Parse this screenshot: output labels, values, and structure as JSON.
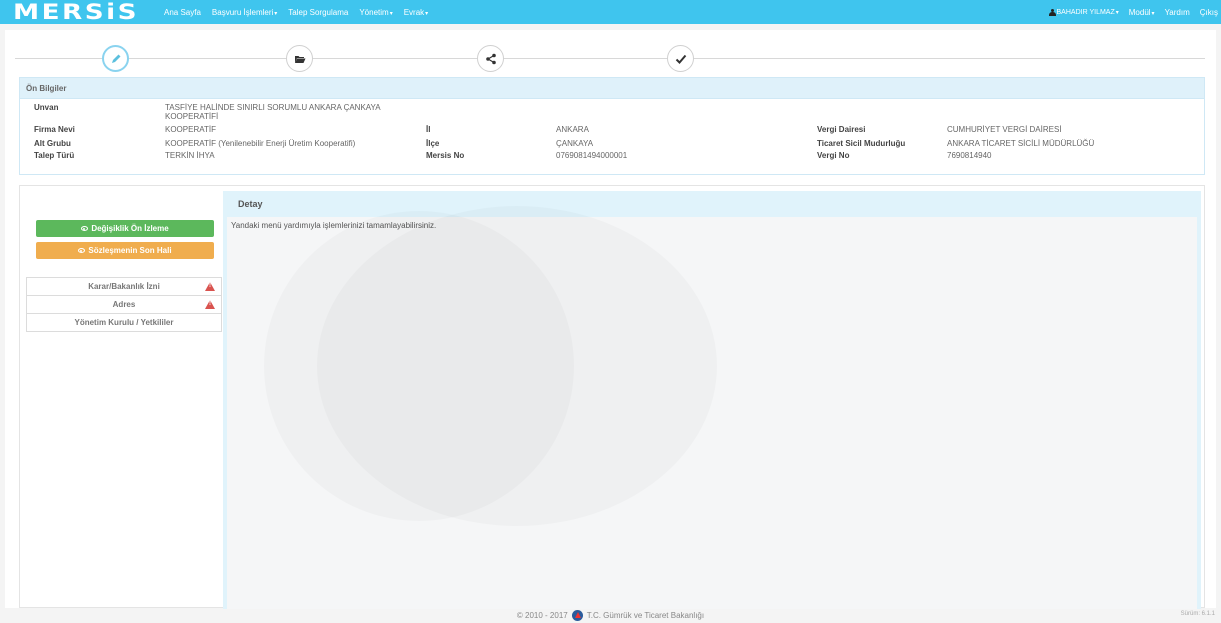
{
  "navbar": {
    "brand": "MERSiS",
    "items": [
      {
        "label": "Ana Sayfa",
        "caret": ""
      },
      {
        "label": "Başvuru İşlemleri",
        "caret": "▾"
      },
      {
        "label": "Talep Sorgulama",
        "caret": ""
      },
      {
        "label": "Yönetim",
        "caret": "▾"
      },
      {
        "label": "Evrak",
        "caret": "▾"
      }
    ],
    "user": "BAHADIR YILMAZ",
    "user_caret": "▾",
    "modul": "Modül",
    "modul_caret": "▾",
    "yardim": "Yardım",
    "cikis": "Çıkış"
  },
  "wizard": {
    "icons": [
      "pencil-icon",
      "folder-open-icon",
      "share-icon",
      "check-icon"
    ],
    "active_step": 1
  },
  "on_bilgiler": {
    "title": "Ön Bilgiler",
    "unvan_label": "Unvan",
    "unvan_line1": "TASFİYE HALİNDE SINIRLI SORUMLU ANKARA ÇANKAYA",
    "unvan_line2": "KOOPERATİFİ",
    "firma_nevi_label": "Firma Nevi",
    "firma_nevi": "KOOPERATİF",
    "alt_grubu_label": "Alt Grubu",
    "alt_grubu": "KOOPERATİF (Yenilenebilir Enerji Üretim Kooperatifi)",
    "talep_turu_label": "Talep Türü",
    "talep_turu": "TERKİN İHYA",
    "il_label": "İl",
    "il": "ANKARA",
    "ilce_label": "İlçe",
    "ilce": "ÇANKAYA",
    "mersis_no_label": "Mersis No",
    "mersis_no": "0769081494000001",
    "vergi_dairesi_label": "Vergi Dairesi",
    "vergi_dairesi": "CUMHURİYET VERGİ DAİRESİ",
    "ticaret_sicil_label": "Ticaret Sicil Mudurluğu",
    "ticaret_sicil": "ANKARA TİCARET SİCİLİ MÜDÜRLÜĞÜ",
    "vergi_no_label": "Vergi No",
    "vergi_no": "7690814940"
  },
  "actions": {
    "preview": "Değişiklik Ön İzleme",
    "final": "Sözleşmenin Son Hali"
  },
  "menu": [
    {
      "label": "Karar/Bakanlık İzni",
      "warning": true
    },
    {
      "label": "Adres",
      "warning": true
    },
    {
      "label": "Yönetim Kurulu / Yetkililer",
      "warning": false
    }
  ],
  "detail": {
    "title": "Detay",
    "text": "Yandaki menü yardımıyla işlemlerinizi tamamlayabilirsiniz."
  },
  "footer": {
    "copyright": "© 2010 - 2017",
    "ministry": "T.C. Gümrük ve Ticaret Bakanlığı",
    "version": "Sürüm: 6.1.1"
  },
  "colors": {
    "navbar": "#3fc5ee",
    "green": "#5cb85c",
    "orange": "#f0ad4e",
    "danger": "#d9534f"
  }
}
